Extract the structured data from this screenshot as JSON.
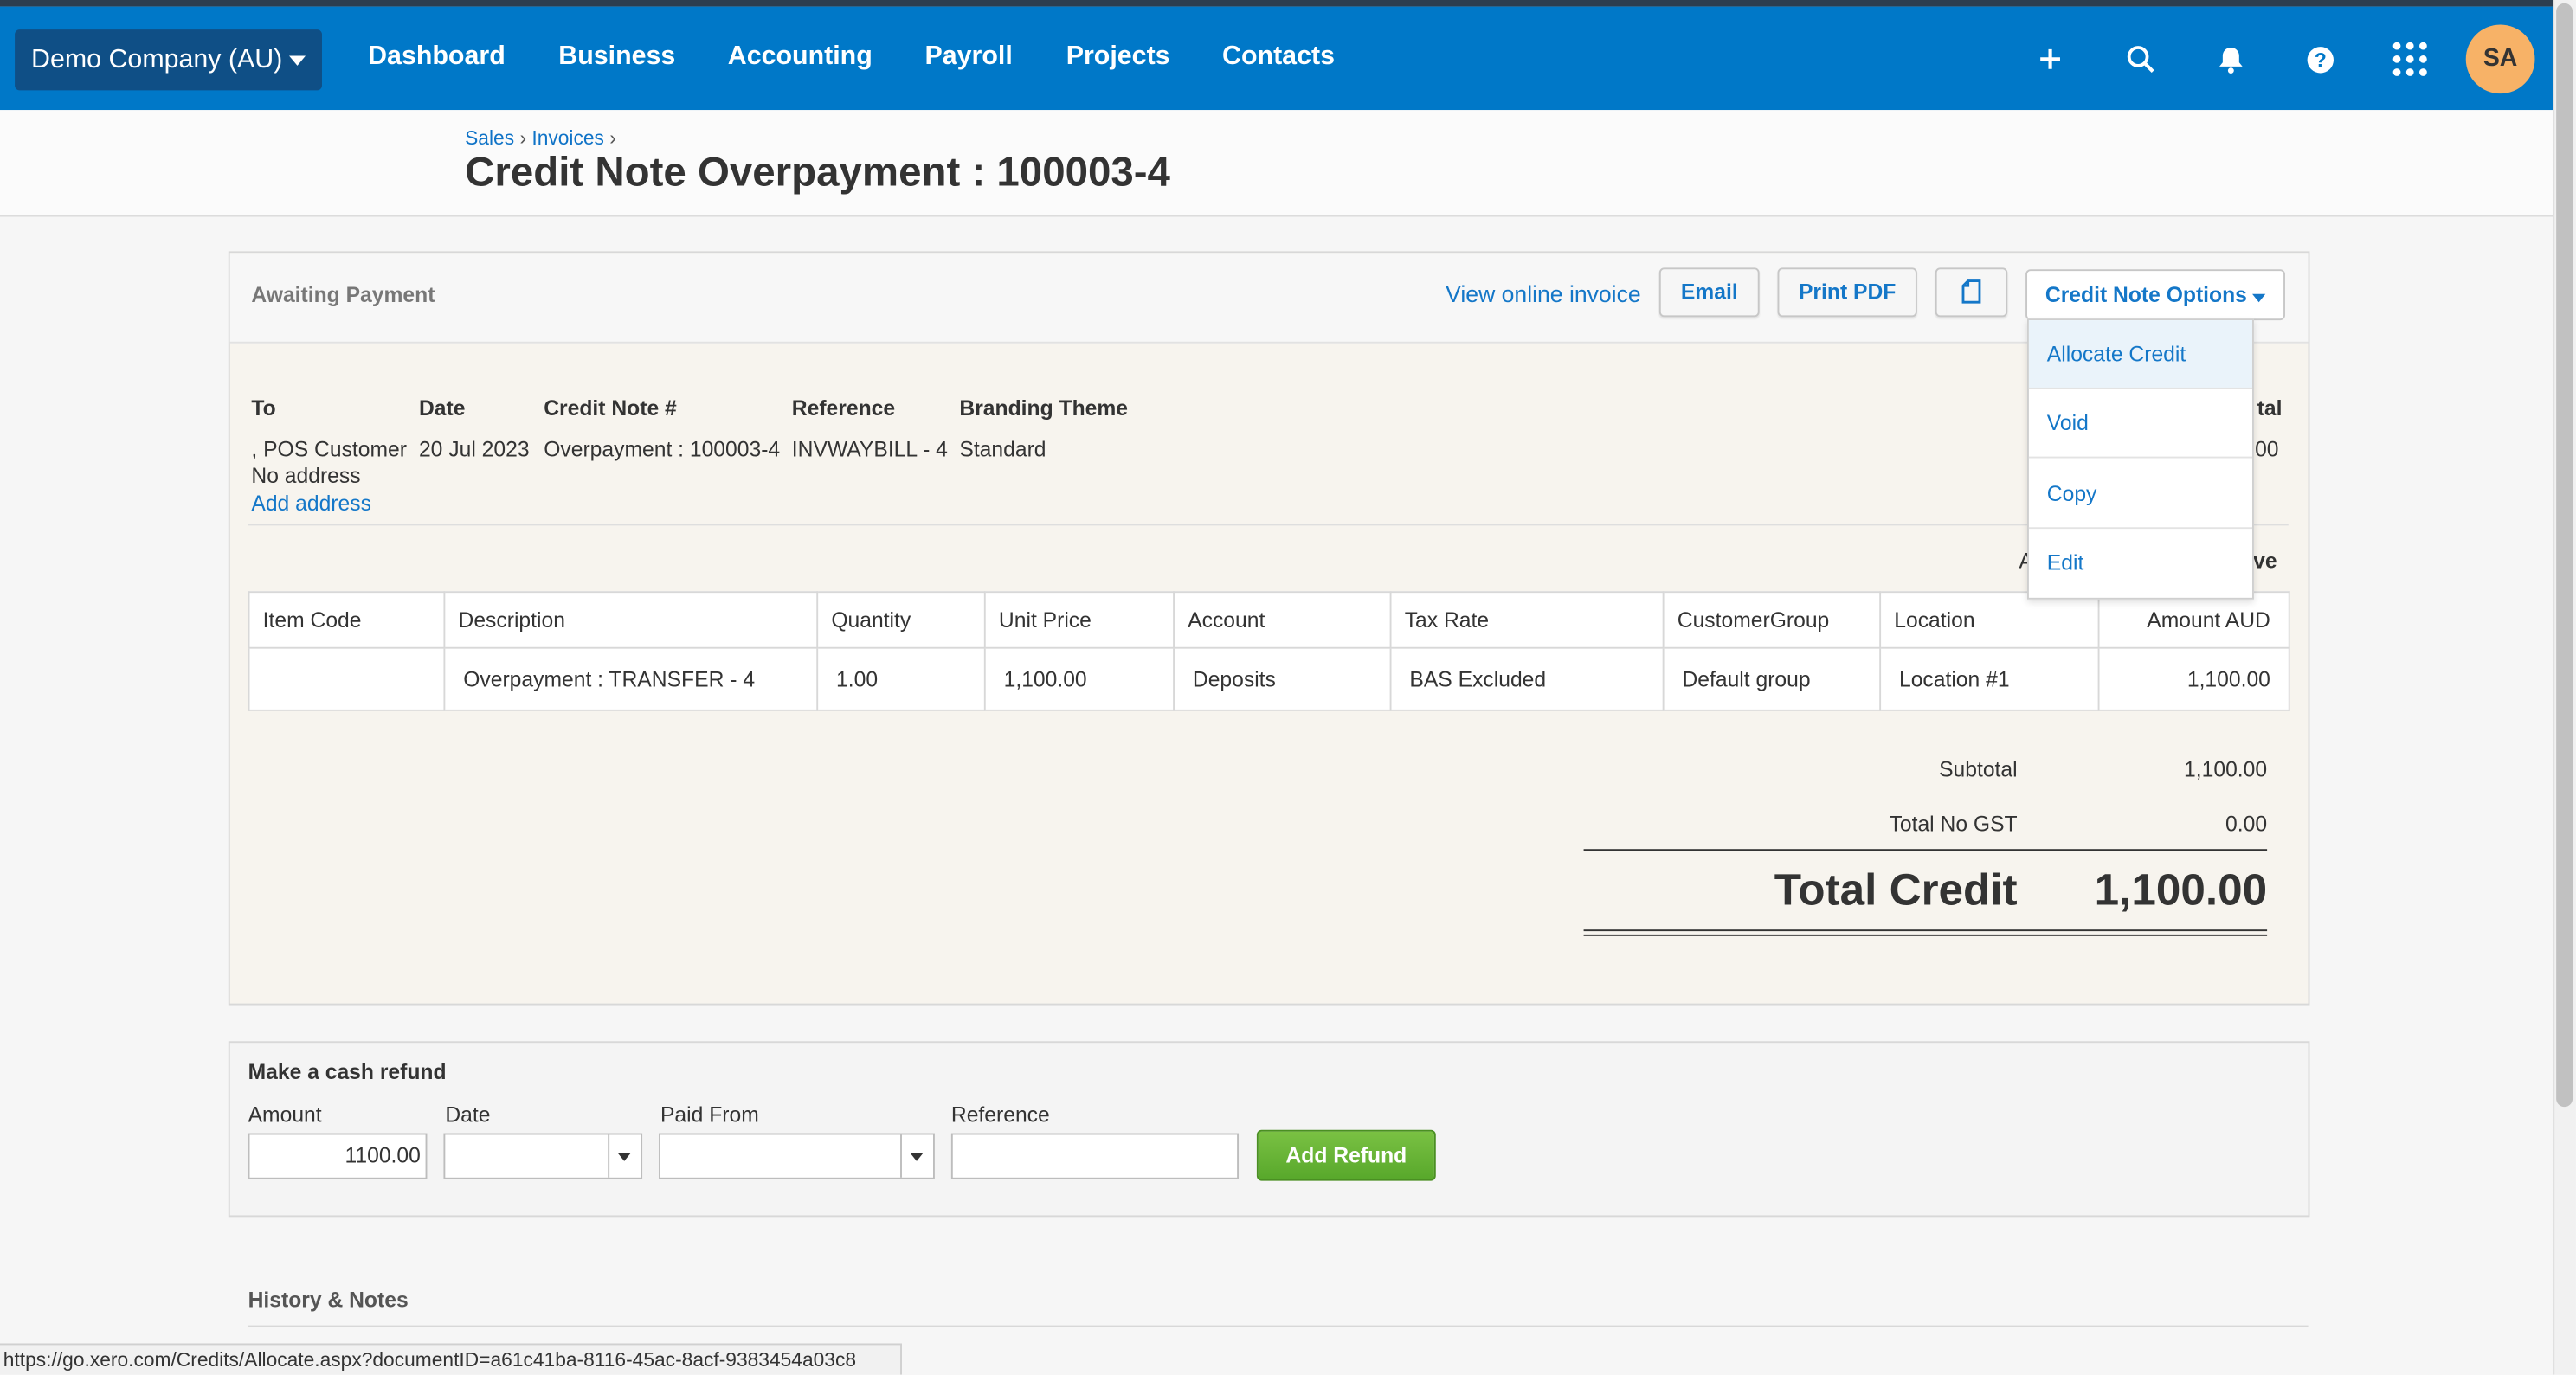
{
  "nav": {
    "org": "Demo Company (AU)",
    "links": [
      "Dashboard",
      "Business",
      "Accounting",
      "Payroll",
      "Projects",
      "Contacts"
    ],
    "avatar": "SA",
    "icons": [
      "plus-icon",
      "search-icon",
      "bell-icon",
      "help-icon",
      "apps-grid-icon"
    ]
  },
  "breadcrumb": {
    "items": [
      "Sales",
      "Invoices"
    ],
    "sep": "›"
  },
  "page": {
    "title": "Credit Note Overpayment : 100003-4"
  },
  "panel": {
    "status": "Awaiting Payment",
    "view_online": "View online invoice",
    "email": "Email",
    "print_pdf": "Print PDF",
    "copy_icon": "document-copy-icon",
    "options": "Credit Note Options"
  },
  "meta": {
    "to_label": "To",
    "to_value": ", POS Customer",
    "no_address": "No address",
    "add_address": "Add address",
    "date_label": "Date",
    "date_value": "20 Jul 2023",
    "number_label": "Credit Note #",
    "number_value": "Overpayment : 100003-4",
    "reference_label": "Reference",
    "reference_value": "INVWAYBILL - 4",
    "branding_label": "Branding Theme",
    "branding_value": "Standard",
    "total_label_partial": "tal",
    "total_value_partial": ".00",
    "amounts_partial_left": "A",
    "amounts_partial_right": "ive"
  },
  "dropdown": {
    "items": [
      "Allocate Credit",
      "Void",
      "Copy",
      "Edit"
    ]
  },
  "table": {
    "headers": [
      "Item Code",
      "Description",
      "Quantity",
      "Unit Price",
      "Account",
      "Tax Rate",
      "CustomerGroup",
      "Location",
      "Amount AUD"
    ],
    "rows": [
      [
        "",
        "Overpayment : TRANSFER - 4",
        "1.00",
        "1,100.00",
        "Deposits",
        "BAS Excluded",
        "Default group",
        "Location #1",
        "1,100.00"
      ]
    ]
  },
  "totals": {
    "subtotal_label": "Subtotal",
    "subtotal_value": "1,100.00",
    "gst_label": "Total No GST",
    "gst_value": "0.00",
    "total_label": "Total Credit",
    "total_value": "1,100.00"
  },
  "refund": {
    "title": "Make a cash refund",
    "amount_label": "Amount",
    "amount_value": "1100.00",
    "date_label": "Date",
    "paid_from_label": "Paid From",
    "reference_label": "Reference",
    "add_refund": "Add Refund"
  },
  "history": {
    "title": "History & Notes"
  },
  "statusbar": {
    "url": "https://go.xero.com/Credits/Allocate.aspx?documentID=a61c41ba-8116-45ac-8acf-9383454a03c8"
  },
  "colors": {
    "nav": "#0078c8",
    "link": "#1477c8",
    "green": "#6bb83a",
    "avatar": "#f7b267"
  }
}
